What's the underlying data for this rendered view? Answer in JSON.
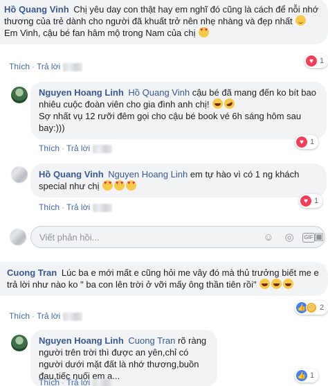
{
  "comments": [
    {
      "author": "Hồ Quang Vinh",
      "text_1": "Chị yêu day con thật hay em nghĩ đó cũng là cách để nỗi nhớ thương của trẻ dành cho người đã khuất trở nên nhẹ nhàng và đẹp nhất",
      "text_2": "Em Vinh, cậu bé fan hâm mộ trong Nam của chị",
      "like_label": "Thích",
      "reply_label": "Trả lời",
      "reaction_count": "1",
      "replies": [
        {
          "author": "Nguyen Hoang Linh",
          "mention": "Hồ Quang Vinh",
          "text_1": "cậu bé đã mang đến ko bít bao nhiêu cuộc đoàn viên cho gia đình anh chị!",
          "text_2": "Sợ nhất vụ 12 rưỡi đêm gọi cho cậu bé book vé 6h sáng hôm sau bay:)))",
          "like_label": "Thích",
          "reply_label": "Trả lời",
          "reaction_count": "1"
        },
        {
          "author": "Hồ Quang Vinh",
          "mention": "Nguyen Hoang Linh",
          "text_1": "em tự hào vì có 1 ng khách special như chị",
          "like_label": "Thích",
          "reply_label": "Trả lời",
          "reaction_count": "1"
        }
      ]
    },
    {
      "author": "Cuong Tran",
      "text_1": "Lúc ba e mới mất e cũng hỏi me vây đó mà thủ trưởng biết me e trả lời như nào ko \" ba con lên trời ở vỡi mấy ông thần tiên rồi\"",
      "like_label": "Thích",
      "reply_label": "Trả lời",
      "reaction_count": "2",
      "replies": [
        {
          "author": "Nguyen Hoang Linh",
          "mention": "Cuong Tran",
          "text_1": "rõ ràng người trên trời thì được an yên,chỉ có người dưới mặt đất là nhớ thương,buồn đau,tiếc nuối em ạ...",
          "like_label": "Thích",
          "reply_label": "Trả lời",
          "reaction_count": "1"
        }
      ]
    }
  ],
  "reply_input": {
    "placeholder": "Viết phản hồi..."
  },
  "icons": [
    "smiley-icon",
    "camera-icon",
    "gif-icon",
    "sticker-icon",
    "heart-reaction-icon",
    "like-reaction-icon",
    "sad-reaction-icon"
  ],
  "colors": {
    "author": "#385898",
    "bubble": "#f2f3f5",
    "action": "#4267b2",
    "heart": "#f33e58",
    "like": "#4080ff"
  }
}
